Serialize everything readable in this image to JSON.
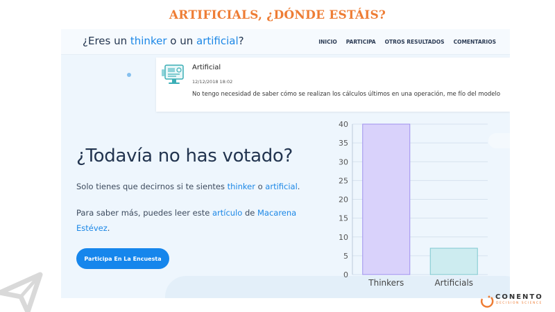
{
  "slide": {
    "title": "ARTIFICIALS, ¿DÓNDE ESTÁIS?"
  },
  "header": {
    "brand": {
      "part1": "¿Eres un ",
      "thinker": "thinker",
      "part2": " o un ",
      "artificial": "artificial",
      "part3": "?"
    },
    "nav": [
      "INICIO",
      "PARTICIPA",
      "OTROS RESULTADOS",
      "COMENTARIOS"
    ]
  },
  "comment": {
    "author": "Artificial",
    "date": "12/12/2018 18:02",
    "text": "No tengo necesidad de saber cómo se realizan los cálculos últimos en una operación, me fío del modelo"
  },
  "hero": {
    "headline": "¿Todavía no has votado?",
    "p1_a": "Solo tienes que decirnos si te sientes ",
    "p1_link1": "thinker",
    "p1_b": " o ",
    "p1_link2": "artificial",
    "p1_c": ".",
    "p2_a": "Para saber más, puedes leer este ",
    "p2_link1": "artículo",
    "p2_b": " de ",
    "p2_link2": "Macarena Estévez",
    "p2_c": ".",
    "cta": "Participa En La Encuesta"
  },
  "chart_data": {
    "type": "bar",
    "categories": [
      "Thinkers",
      "Artificials"
    ],
    "values": [
      40,
      7
    ],
    "colors": [
      "#d9d2fb",
      "#cdecf0"
    ],
    "borders": [
      "#9f90ee",
      "#7fc8d0"
    ],
    "ylim": [
      0,
      40
    ],
    "yticks": [
      0,
      5,
      10,
      15,
      20,
      25,
      30,
      35,
      40
    ],
    "grid": true
  },
  "logo": {
    "name": "CONENTO",
    "tagline": "DECISION SCIENCE"
  }
}
